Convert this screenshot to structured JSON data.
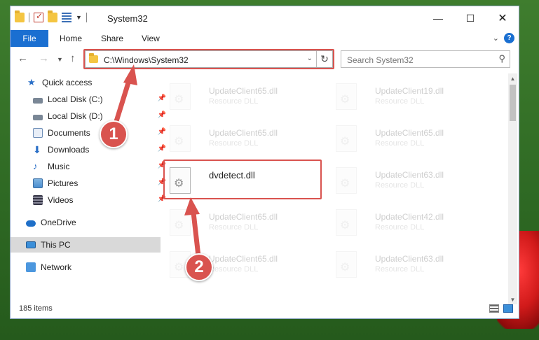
{
  "window": {
    "title": "System32",
    "minimize_glyph": "—",
    "maximize_glyph": "☐",
    "close_glyph": "✕"
  },
  "ribbon": {
    "tabs": [
      "File",
      "Home",
      "Share",
      "View"
    ]
  },
  "navigation": {
    "address": "C:\\Windows\\System32",
    "search_placeholder": "Search System32"
  },
  "sidebar": {
    "items": [
      {
        "label": "Quick access",
        "icon": "star-icon",
        "pinned": false
      },
      {
        "label": "Local Disk (C:)",
        "icon": "drive-icon",
        "pinned": true
      },
      {
        "label": "Local Disk (D:)",
        "icon": "drive-icon",
        "pinned": true
      },
      {
        "label": "Documents",
        "icon": "documents-icon",
        "pinned": true
      },
      {
        "label": "Downloads",
        "icon": "downloads-icon",
        "pinned": true
      },
      {
        "label": "Music",
        "icon": "music-icon",
        "pinned": true
      },
      {
        "label": "Pictures",
        "icon": "pictures-icon",
        "pinned": true
      },
      {
        "label": "Videos",
        "icon": "videos-icon",
        "pinned": true
      },
      {
        "label": "OneDrive",
        "icon": "onedrive-icon",
        "pinned": false
      },
      {
        "label": "This PC",
        "icon": "this-pc-icon",
        "pinned": false,
        "selected": true
      },
      {
        "label": "Network",
        "icon": "network-icon",
        "pinned": false
      }
    ]
  },
  "files": [
    {
      "name": "UpdateClient65.dll",
      "type": "Resource DLL"
    },
    {
      "name": "UpdateClient19.dll",
      "type": "Resource DLL"
    },
    {
      "name": "UpdateClient65.dll",
      "type": "Resource DLL"
    },
    {
      "name": "UpdateClient65.dll",
      "type": "Resource DLL"
    },
    {
      "name": "dvdetect.dll",
      "type": ""
    },
    {
      "name": "UpdateClient63.dll",
      "type": "Resource DLL"
    },
    {
      "name": "UpdateClient65.dll",
      "type": "Resource DLL"
    },
    {
      "name": "UpdateClient42.dll",
      "type": "Resource DLL"
    },
    {
      "name": "UpdateClient65.dll",
      "type": "Resource DLL"
    },
    {
      "name": "UpdateClient63.dll",
      "type": "Resource DLL"
    }
  ],
  "status": {
    "item_count": "185 items"
  },
  "callouts": {
    "step1": "1",
    "step2": "2"
  },
  "colors": {
    "accent": "#1a6fd1",
    "highlight": "#d9534f"
  }
}
